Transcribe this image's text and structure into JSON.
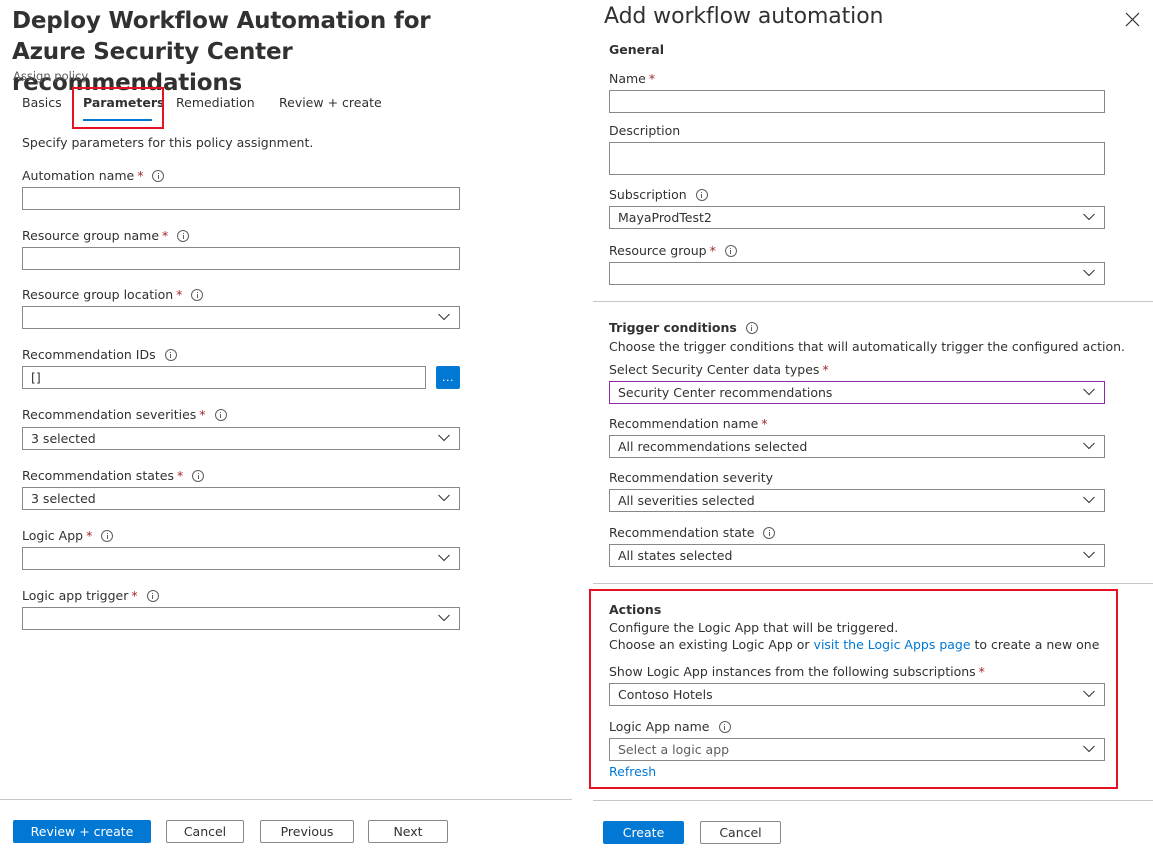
{
  "left": {
    "title": "Deploy Workflow Automation for Azure Security Center recommendations",
    "subtitle": "Assign policy",
    "tabs": [
      {
        "label": "Basics",
        "active": false
      },
      {
        "label": "Parameters",
        "active": true
      },
      {
        "label": "Remediation",
        "active": false
      },
      {
        "label": "Review + create",
        "active": false
      }
    ],
    "intro": "Specify parameters for this policy assignment.",
    "fields": {
      "automation_name": {
        "label": "Automation name",
        "required": true,
        "value": ""
      },
      "resource_group_name": {
        "label": "Resource group name",
        "required": true,
        "value": ""
      },
      "resource_group_location": {
        "label": "Resource group location",
        "required": true,
        "value": ""
      },
      "recommendation_ids": {
        "label": "Recommendation IDs",
        "required": false,
        "value": "[]",
        "browse_label": "..."
      },
      "recommendation_severities": {
        "label": "Recommendation severities",
        "required": true,
        "value": "3 selected"
      },
      "recommendation_states": {
        "label": "Recommendation states",
        "required": true,
        "value": "3 selected"
      },
      "logic_app": {
        "label": "Logic App",
        "required": true,
        "value": ""
      },
      "logic_app_trigger": {
        "label": "Logic app trigger",
        "required": true,
        "value": ""
      }
    },
    "footer": {
      "review_create": "Review + create",
      "cancel": "Cancel",
      "previous": "Previous",
      "next": "Next"
    }
  },
  "right": {
    "title": "Add workflow automation",
    "required_marker": "*",
    "general": {
      "heading": "General",
      "name": {
        "label": "Name",
        "value": ""
      },
      "description": {
        "label": "Description",
        "value": ""
      },
      "subscription": {
        "label": "Subscription",
        "value": "MayaProdTest2"
      },
      "resource_group": {
        "label": "Resource group",
        "value": ""
      }
    },
    "trigger": {
      "heading": "Trigger conditions",
      "description": "Choose the trigger conditions that will automatically trigger the configured action.",
      "data_types": {
        "label": "Select Security Center data types",
        "value": "Security Center recommendations"
      },
      "recommendation_name": {
        "label": "Recommendation name",
        "value": "All recommendations selected"
      },
      "recommendation_severity": {
        "label": "Recommendation severity",
        "value": "All severities selected"
      },
      "recommendation_state": {
        "label": "Recommendation state",
        "value": "All states selected"
      }
    },
    "actions": {
      "heading": "Actions",
      "line1": "Configure the Logic App that will be triggered.",
      "line2_prefix": "Choose an existing Logic App or ",
      "line2_link": "visit the Logic Apps page",
      "line2_suffix": " to create a new one",
      "subscriptions": {
        "label": "Show Logic App instances from the following subscriptions",
        "value": "Contoso Hotels"
      },
      "logic_app_name": {
        "label": "Logic App name",
        "placeholder": "Select a logic app"
      },
      "refresh": "Refresh"
    },
    "footer": {
      "create": "Create",
      "cancel": "Cancel"
    }
  },
  "colors": {
    "accent": "#0078d4",
    "highlight": "#e81123",
    "required": "#a4262c",
    "focus_border": "#8a2da5"
  }
}
